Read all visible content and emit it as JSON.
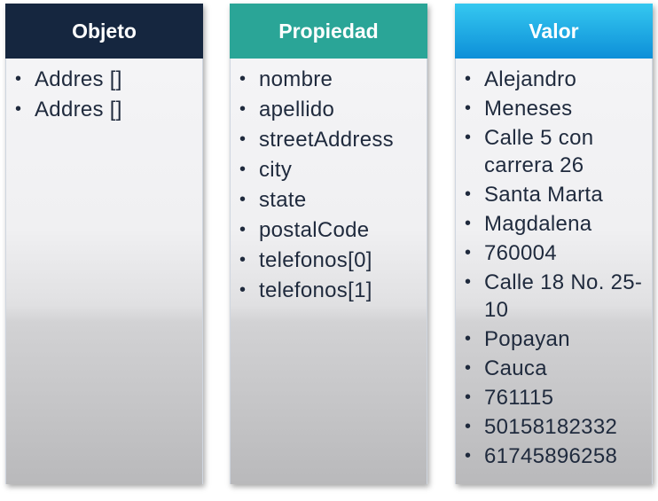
{
  "columns": {
    "objeto": {
      "title": "Objeto",
      "items": [
        "Addres []",
        "Addres []"
      ]
    },
    "propiedad": {
      "title": "Propiedad",
      "items": [
        "nombre",
        "apellido",
        "streetAddress",
        "city",
        "state",
        "postalCode",
        "telefonos[0]",
        "telefonos[1]"
      ]
    },
    "valor": {
      "title": "Valor",
      "items": [
        "Alejandro",
        "Meneses",
        "Calle 5 con carrera 26",
        "Santa Marta",
        "Magdalena",
        "760004",
        "Calle 18 No. 25-10",
        "Popayan",
        "Cauca",
        "761115",
        "50158182332",
        "61745896258"
      ]
    }
  },
  "colors": {
    "objeto_header": "#15263f",
    "propiedad_header": "#2aa597",
    "valor_header": "#1aa8e6"
  }
}
